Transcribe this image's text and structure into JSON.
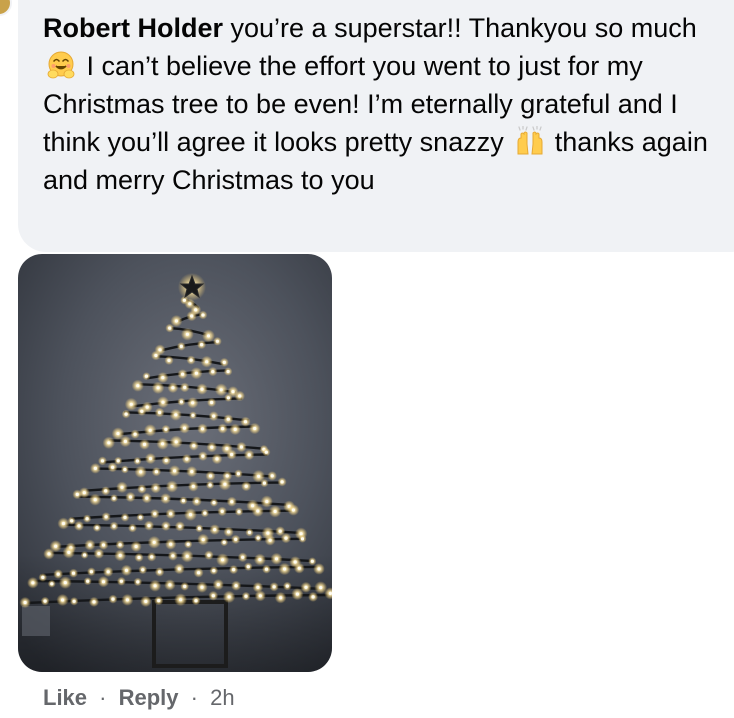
{
  "comment": {
    "author": "Robert Holder",
    "text_part1": " you’re a superstar!! Thankyou so much ",
    "text_part2": " I can’t believe the effort you went to just for my Christmas tree to be even! I’m eternally grateful and I think you’ll agree it looks pretty snazzy ",
    "text_part3": " thanks again and merry Christmas to you",
    "emoji_1": "hugging-face-icon",
    "emoji_2": "raising-hands-icon"
  },
  "photo": {
    "subject": "christmas-lights-wall-tree-icon"
  },
  "actions": {
    "like_label": "Like",
    "separator_1": "·",
    "reply_label": "Reply",
    "separator_2": "·",
    "time": "2h"
  },
  "colors": {
    "bubble_bg": "#f0f2f5",
    "text": "#050505",
    "meta_text": "#65676b",
    "light_glow": "#ffe9a8"
  }
}
